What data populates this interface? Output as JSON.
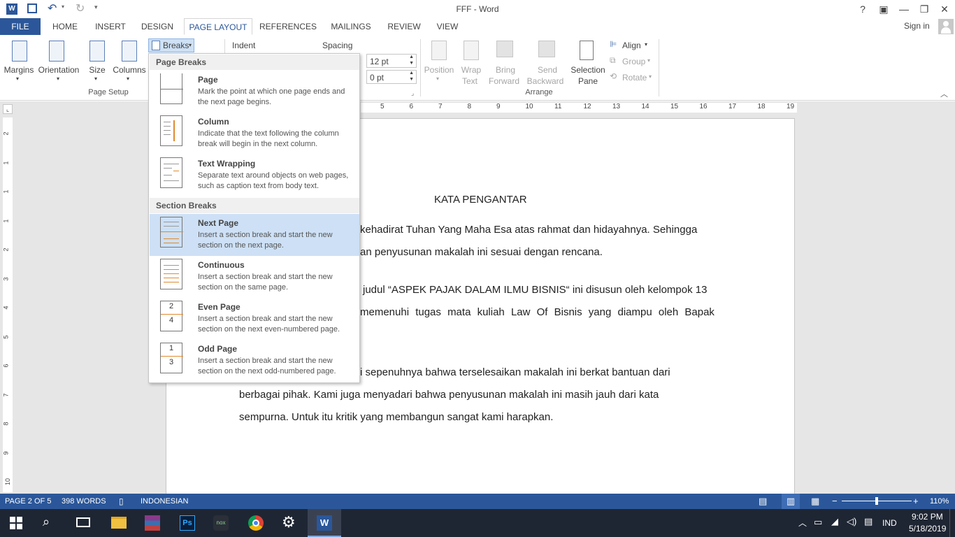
{
  "window": {
    "title": "FFF - Word",
    "help": "?",
    "sign_in": "Sign in"
  },
  "quick_access": [
    "save-icon",
    "undo-icon",
    "redo-icon",
    "customize-icon"
  ],
  "tabs": [
    {
      "label": "FILE"
    },
    {
      "label": "HOME"
    },
    {
      "label": "INSERT"
    },
    {
      "label": "DESIGN"
    },
    {
      "label": "PAGE LAYOUT"
    },
    {
      "label": "REFERENCES"
    },
    {
      "label": "MAILINGS"
    },
    {
      "label": "REVIEW"
    },
    {
      "label": "VIEW"
    }
  ],
  "ribbon": {
    "page_setup": {
      "margins": "Margins",
      "orientation": "Orientation",
      "size": "Size",
      "columns": "Columns",
      "breaks": "Breaks",
      "group_label": "Page Setup"
    },
    "paragraph": {
      "indent": "Indent",
      "spacing": "Spacing",
      "before_value": "12 pt",
      "after_value": "0 pt"
    },
    "arrange": {
      "position": "Position",
      "wrap_text_1": "Wrap",
      "wrap_text_2": "Text",
      "bring_forward_1": "Bring",
      "bring_forward_2": "Forward",
      "send_backward_1": "Send",
      "send_backward_2": "Backward",
      "selection_pane_1": "Selection",
      "selection_pane_2": "Pane",
      "align": "Align",
      "group": "Group",
      "rotate": "Rotate",
      "group_label": "Arrange"
    }
  },
  "ruler": {
    "h_ticks": [
      "5",
      "6",
      "7",
      "8",
      "9",
      "10",
      "11",
      "12",
      "13",
      "14",
      "15",
      "16",
      "17",
      "18",
      "19"
    ],
    "v_ticks": [
      "2",
      "1",
      "1",
      "1",
      "2",
      "3",
      "4",
      "5",
      "6",
      "7",
      "8",
      "9",
      "10"
    ]
  },
  "breaks_menu": {
    "page_breaks_header": "Page Breaks",
    "section_breaks_header": "Section Breaks",
    "items": [
      {
        "title": "Page",
        "desc": "Mark the point at which one page ends and the next page begins."
      },
      {
        "title": "Column",
        "desc": "Indicate that the text following the column break will begin in the next column."
      },
      {
        "title": "Text Wrapping",
        "desc": "Separate text around objects on web pages, such as caption text from body text."
      },
      {
        "title": "Next Page",
        "desc": "Insert a section break and start the new section on the next page."
      },
      {
        "title": "Continuous",
        "desc": "Insert a section break and start the new section on the same page."
      },
      {
        "title": "Even Page",
        "desc": "Insert a section break and start the new section on the next even-numbered page."
      },
      {
        "title": "Odd Page",
        "desc": "Insert a section break and start the new section on the next odd-numbered page."
      }
    ]
  },
  "document": {
    "heading": "KATA PENGANTAR",
    "lines": [
      "kehadirat Tuhan Yang Maha Esa atas rahmat dan hidayahnya. Sehingga",
      "an penyusunan makalah ini sesuai dengan rencana.",
      "judul “ASPEK PAJAK DALAM ILMU BISNIS“ ini disusun oleh kelompok 13",
      "memenuhi tugas mata kuliah Law Of Bisnis yang diampu oleh Bapak",
      "i  sepenuhnya  bahwa  terselesaikan  makalah  ini  berkat  bantuan  dari",
      "berbagai  pihak.  Kami  juga  menyadari  bahwa  penyusunan  makalah  ini  masih  jauh  dari  kata",
      "sempurna. Untuk itu kritik yang membangun sangat kami harapkan."
    ]
  },
  "status": {
    "page": "PAGE 2 OF 5",
    "words": "398 WORDS",
    "language": "INDONESIAN",
    "zoom": "110%",
    "zoom_minus": "−",
    "zoom_plus": "+"
  },
  "taskbar": {
    "language": "IND",
    "time": "9:02 PM",
    "date": "5/18/2019",
    "apps": [
      "windows-start",
      "search",
      "task-view",
      "file-explorer",
      "winrar",
      "photoshop",
      "nox",
      "chrome",
      "settings",
      "word"
    ]
  },
  "colors": {
    "accent": "#2b579a",
    "highlight": "#cde0f5",
    "taskbar": "#1f2633"
  }
}
